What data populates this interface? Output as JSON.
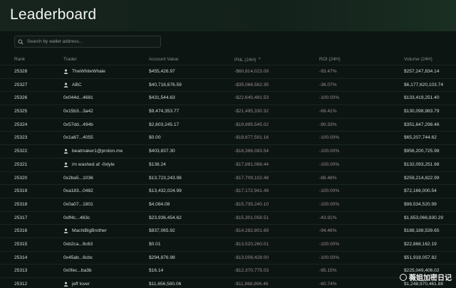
{
  "page": {
    "title": "Leaderboard"
  },
  "search": {
    "placeholder": "Search by wallet address..."
  },
  "columns": {
    "rank": "Rank",
    "trader": "Trader",
    "account_value": "Account Value",
    "pnl": "PNL (24H)",
    "roi": "ROI (24H)",
    "volume": "Volume (24H)"
  },
  "sort": {
    "column": "pnl",
    "icon": "chevron-up-icon"
  },
  "rows": [
    {
      "rank": "25328",
      "trader": "TheWhiteWhale",
      "icon": true,
      "account": "$455,426.97",
      "pnl": "-$60,814,023.09",
      "roi": "-93.47%",
      "volume": "$257,247,834.14"
    },
    {
      "rank": "25327",
      "trader": "ABC",
      "icon": true,
      "account": "$40,718,676.59",
      "pnl": "-$35,066,562.35",
      "roi": "-36.07%",
      "volume": "$6,177,620,103.74"
    },
    {
      "rank": "25326",
      "trader": "0x044d...4681",
      "icon": false,
      "account": "$431,544.63",
      "pnl": "-$22,640,481.53",
      "roi": "-100.00%",
      "volume": "$133,419,251.40"
    },
    {
      "rank": "25325",
      "trader": "0x15b3...3a42",
      "icon": false,
      "account": "$9,474,353.77",
      "pnl": "-$21,495,330.32",
      "roi": "-69.41%",
      "volume": "$130,098,983.79"
    },
    {
      "rank": "25324",
      "trader": "0x57dd...494b",
      "icon": false,
      "account": "$2,603,245.17",
      "pnl": "-$19,895,545.02",
      "roi": "-90.33%",
      "volume": "$351,647,298.46"
    },
    {
      "rank": "25323",
      "trader": "0x1a67...4055",
      "icon": false,
      "account": "$0.00",
      "pnl": "-$18,677,591.16",
      "roi": "-100.00%",
      "volume": "$65,207,744.62"
    },
    {
      "rank": "25322",
      "trader": "beatmaker1@proton.me",
      "icon": true,
      "account": "$403,837.30",
      "pnl": "-$18,366,083.54",
      "roi": "-100.00%",
      "volume": "$956,200,725.98"
    },
    {
      "rank": "25321",
      "trader": "im washed af -0xlyle",
      "icon": true,
      "account": "$138.24",
      "pnl": "-$17,881,068.44",
      "roi": "-100.00%",
      "volume": "$132,093,251.98"
    },
    {
      "rank": "25320",
      "trader": "0x2ba5...1036",
      "icon": false,
      "account": "$13,723,243.98",
      "pnl": "-$17,709,102.48",
      "roi": "-88.48%",
      "volume": "$259,214,822.99"
    },
    {
      "rank": "25319",
      "trader": "0xa183...0482",
      "icon": false,
      "account": "$13,432,024.99",
      "pnl": "-$17,172,941.49",
      "roi": "-100.00%",
      "volume": "$72,166,000.54"
    },
    {
      "rank": "25318",
      "trader": "0x0a07...1801",
      "icon": false,
      "account": "$4,084.08",
      "pnl": "-$15,735,240.10",
      "roi": "-100.00%",
      "volume": "$98,534,520.99"
    },
    {
      "rank": "25317",
      "trader": "0xff4c...463c",
      "icon": false,
      "account": "$23,936,454.62",
      "pnl": "-$15,301,058.51",
      "roi": "-43.91%",
      "volume": "$1,653,066,830.29"
    },
    {
      "rank": "25316",
      "trader": "MachiBigBrother",
      "icon": true,
      "account": "$837,065.92",
      "pnl": "-$14,282,801.69",
      "roi": "-94.46%",
      "volume": "$188,188,539.65"
    },
    {
      "rank": "25315",
      "trader": "0xb2ca...9c63",
      "icon": false,
      "account": "$0.01",
      "pnl": "-$13,520,260.01",
      "roi": "-100.00%",
      "volume": "$22,868,162.19"
    },
    {
      "rank": "25314",
      "trader": "0x45ab...6cbc",
      "icon": false,
      "account": "$294,876.98",
      "pnl": "-$13,008,428.00",
      "roi": "-100.00%",
      "volume": "$51,918,057.82"
    },
    {
      "rank": "25313",
      "trader": "0x0fec...ba3b",
      "icon": false,
      "account": "$16.14",
      "pnl": "-$12,370,775.03",
      "roi": "-95.15%",
      "volume": "$225,049,406.02"
    },
    {
      "rank": "25312",
      "trader": "jeff lover",
      "icon": true,
      "account": "$11,656,580.06",
      "pnl": "-$11,868,896.46",
      "roi": "-60.74%",
      "volume": "$1,248,970,461.88"
    }
  ],
  "watermark": {
    "text": "薇姐加密日记"
  }
}
